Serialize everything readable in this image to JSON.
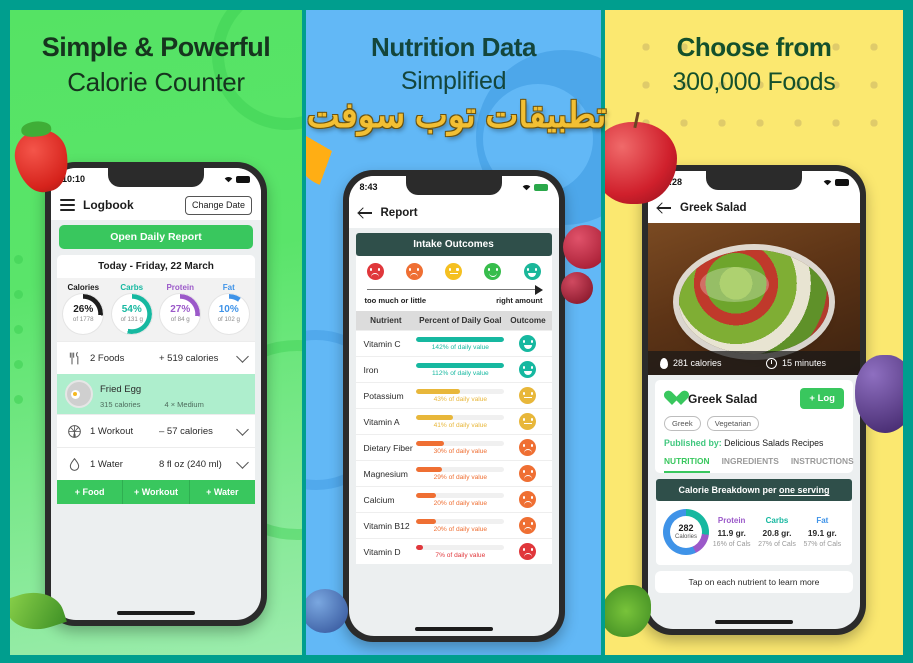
{
  "watermark": "تطبيقات توب سوفت",
  "panels": [
    {
      "id": "calorie-counter",
      "bg_color": "#55e364",
      "headline_1": "Simple & Powerful",
      "headline_2": "Calorie Counter",
      "phone": {
        "status_time": "10:10",
        "nav_title": "Logbook",
        "change_date_label": "Change Date",
        "open_report_label": "Open Daily Report",
        "date_label": "Today - Friday, 22 March",
        "macros": [
          {
            "label": "Calories",
            "percent": "26%",
            "of": "of 1778",
            "color": "#1c1c1c",
            "deg": 94
          },
          {
            "label": "Carbs",
            "percent": "54%",
            "of": "of 131 g",
            "color": "#16b8a0",
            "deg": 194
          },
          {
            "label": "Protein",
            "percent": "27%",
            "of": "of 84 g",
            "color": "#9b59c9",
            "deg": 97
          },
          {
            "label": "Fat",
            "percent": "10%",
            "of": "of 102 g",
            "color": "#3f93e8",
            "deg": 36
          }
        ],
        "rows": [
          {
            "icon": "cutlery-icon",
            "name": "2 Foods",
            "value": "+ 519 calories"
          },
          {
            "icon": "basketball-icon",
            "name": "1 Workout",
            "value": "– 57 calories"
          },
          {
            "icon": "water-drop-icon",
            "name": "1 Water",
            "value": "8 fl oz (240 ml)"
          }
        ],
        "food_item": {
          "title": "Fried Egg",
          "calories": "315 calories",
          "serving": "4 × Medium"
        },
        "add_buttons": [
          "+ Food",
          "+ Workout",
          "+ Water"
        ]
      }
    },
    {
      "id": "nutrition-report",
      "bg_color": "#62b8f6",
      "headline_1": "Nutrition Data",
      "headline_2": "Simplified",
      "phone": {
        "status_time": "8:43",
        "nav_title": "Report",
        "section_title": "Intake Outcomes",
        "scale_left": "too much or little",
        "scale_right": "right amount",
        "scale_faces": [
          "#e0373b",
          "#ef6f33",
          "#f5c021",
          "#37bd4c",
          "#1bb79a"
        ],
        "columns": [
          "Nutrient",
          "Percent of Daily Goal",
          "Outcome"
        ],
        "rows": [
          {
            "nutrient": "Vitamin C",
            "percent": 142,
            "fill": 100,
            "label": "142% of daily value",
            "color": "#16b8a0",
            "face": "grin"
          },
          {
            "nutrient": "Iron",
            "percent": 112,
            "fill": 100,
            "label": "112% of daily value",
            "color": "#16b8a0",
            "face": "grin"
          },
          {
            "nutrient": "Potassium",
            "percent": 43,
            "fill": 50,
            "label": "43% of daily value",
            "color": "#e8b73a",
            "face": "flat"
          },
          {
            "nutrient": "Vitamin A",
            "percent": 41,
            "fill": 42,
            "label": "41% of daily value",
            "color": "#e8b73a",
            "face": "flat"
          },
          {
            "nutrient": "Dietary Fiber",
            "percent": 30,
            "fill": 32,
            "label": "30% of daily value",
            "color": "#ef6f33",
            "face": "frown"
          },
          {
            "nutrient": "Magnesium",
            "percent": 29,
            "fill": 29,
            "label": "29% of daily value",
            "color": "#ef6f33",
            "face": "frown"
          },
          {
            "nutrient": "Calcium",
            "percent": 20,
            "fill": 22,
            "label": "20% of daily value",
            "color": "#ef6f33",
            "face": "frown"
          },
          {
            "nutrient": "Vitamin B12",
            "percent": 20,
            "fill": 22,
            "label": "20% of daily value",
            "color": "#ef6f33",
            "face": "frown"
          },
          {
            "nutrient": "Vitamin D",
            "percent": 7,
            "fill": 8,
            "label": "7% of daily value",
            "color": "#e0373b",
            "face": "frown"
          }
        ]
      }
    },
    {
      "id": "food-database",
      "bg_color": "#fbe870",
      "headline_1": "Choose from",
      "headline_2": "300,000 Foods",
      "phone": {
        "status_time": "10:28",
        "nav_title": "Greek Salad",
        "hero_calories": "281 calories",
        "hero_time": "15 minutes",
        "recipe_title": "Greek Salad",
        "log_label": "+ Log",
        "tags": [
          "Greek",
          "Vegetarian"
        ],
        "published_label": "Published by:",
        "published_by": "Delicious Salads Recipes",
        "tabs": [
          "NUTRITION",
          "INGREDIENTS",
          "INSTRUCTIONS"
        ],
        "breakdown_title_a": "Calorie Breakdown per ",
        "breakdown_title_b": "one serving",
        "donut_value": "282",
        "donut_label": "Calories",
        "macros": [
          {
            "label": "Protein",
            "grams": "11.9 gr.",
            "pct": "16% of Cals",
            "color": "#9b59c9"
          },
          {
            "label": "Carbs",
            "grams": "20.8 gr.",
            "pct": "27% of Cals",
            "color": "#16b8a0"
          },
          {
            "label": "Fat",
            "grams": "19.1 gr.",
            "pct": "57% of Cals",
            "color": "#3f93e8"
          }
        ],
        "tap_note": "Tap on each nutrient to learn more"
      }
    }
  ]
}
